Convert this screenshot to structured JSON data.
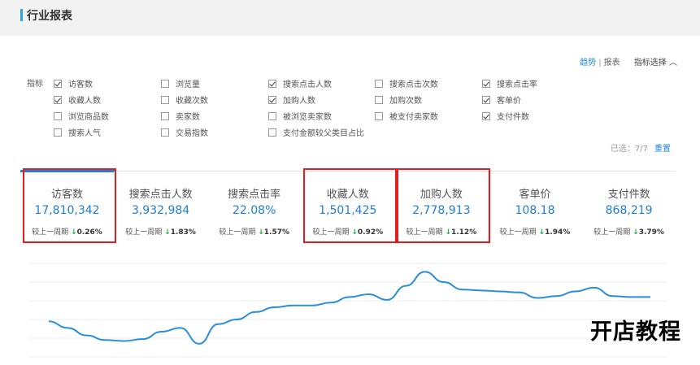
{
  "header": {
    "title": "行业报表"
  },
  "toplinks": {
    "trend": "趋势",
    "separator": "|",
    "report": "报表",
    "filter": "指标选择",
    "filter_icon": "chevron-up-icon"
  },
  "metrics": {
    "label": "指标",
    "options": [
      {
        "label": "访客数",
        "checked": true
      },
      {
        "label": "浏览量",
        "checked": false
      },
      {
        "label": "搜索点击人数",
        "checked": true
      },
      {
        "label": "搜索点击次数",
        "checked": false
      },
      {
        "label": "搜索点击率",
        "checked": true
      },
      {
        "label": "收藏人数",
        "checked": true
      },
      {
        "label": "收藏次数",
        "checked": false
      },
      {
        "label": "加购人数",
        "checked": true
      },
      {
        "label": "加购次数",
        "checked": false
      },
      {
        "label": "客单价",
        "checked": true
      },
      {
        "label": "浏览商品数",
        "checked": false
      },
      {
        "label": "卖家数",
        "checked": false
      },
      {
        "label": "被浏览卖家数",
        "checked": false
      },
      {
        "label": "被支付卖家数",
        "checked": false
      },
      {
        "label": "支付件数",
        "checked": true
      },
      {
        "label": "搜索人气",
        "checked": false
      },
      {
        "label": "交易指数",
        "checked": false
      },
      {
        "label": "支付金额较父类目占比",
        "checked": false
      }
    ]
  },
  "selection": {
    "text": "已选：7/7",
    "reset": "重置"
  },
  "cards": [
    {
      "name": "访客数",
      "value": "17,810,342",
      "compare_label": "较上一周期",
      "arrow": "↓",
      "pct": "0.26%"
    },
    {
      "name": "搜索点击人数",
      "value": "3,932,984",
      "compare_label": "较上一周期",
      "arrow": "↓",
      "pct": "1.83%"
    },
    {
      "name": "搜索点击率",
      "value": "22.08%",
      "compare_label": "较上一周期",
      "arrow": "↓",
      "pct": "1.57%"
    },
    {
      "name": "收藏人数",
      "value": "1,501,425",
      "compare_label": "较上一周期",
      "arrow": "↓",
      "pct": "0.92%"
    },
    {
      "name": "加购人数",
      "value": "2,778,913",
      "compare_label": "较上一周期",
      "arrow": "↓",
      "pct": "1.12%"
    },
    {
      "name": "客单价",
      "value": "108.18",
      "compare_label": "较上一周期",
      "arrow": "↓",
      "pct": "1.94%"
    },
    {
      "name": "支付件数",
      "value": "868,219",
      "compare_label": "较上一周期",
      "arrow": "↓",
      "pct": "3.79%"
    }
  ],
  "chart_data": {
    "type": "line",
    "series": [
      {
        "values": [
          0.38,
          0.31,
          0.23,
          0.18,
          0.17,
          0.19,
          0.27,
          0.31,
          0.14,
          0.35,
          0.4,
          0.48,
          0.53,
          0.55,
          0.55,
          0.58,
          0.64,
          0.67,
          0.61,
          0.76,
          0.91,
          0.8,
          0.72,
          0.71,
          0.7,
          0.69,
          0.63,
          0.65,
          0.7,
          0.74,
          0.65,
          0.64,
          0.64
        ]
      }
    ],
    "color": "#2a8fd8",
    "ylim": [
      0,
      1
    ],
    "grid": true
  },
  "watermark": "开店教程"
}
